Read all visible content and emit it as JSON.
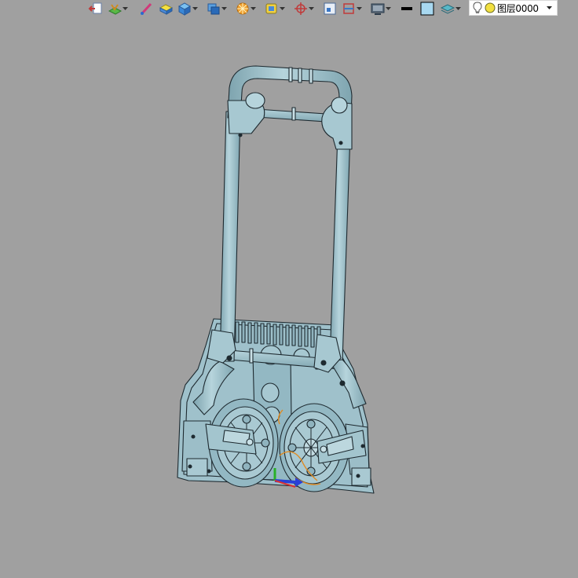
{
  "toolbar": {
    "icons": [
      "exit-sketch-icon",
      "sketch-plane-icon",
      "line-tool-icon",
      "extrude-icon",
      "box-solid-icon",
      "copy-feature-icon",
      "render-style-icon",
      "face-select-icon",
      "axis-locate-icon",
      "zoom-window-icon",
      "section-view-icon",
      "display-mode-icon",
      "line-color-icon",
      "fill-color-icon",
      "layer-stack-icon"
    ]
  },
  "layer_selector": {
    "current": "图层0000",
    "bulb_icon": "lightbulb-icon",
    "color_icon": "yellow-dot-icon",
    "dropdown_icon": "triangle-down-icon"
  },
  "canvas": {
    "background_color": "#a0a0a0",
    "model_color": "#9fc1cb",
    "edge_color": "#1e2a30",
    "axis_colors": {
      "x": "#d93030",
      "y": "#28b028",
      "z": "#2840d8"
    }
  }
}
